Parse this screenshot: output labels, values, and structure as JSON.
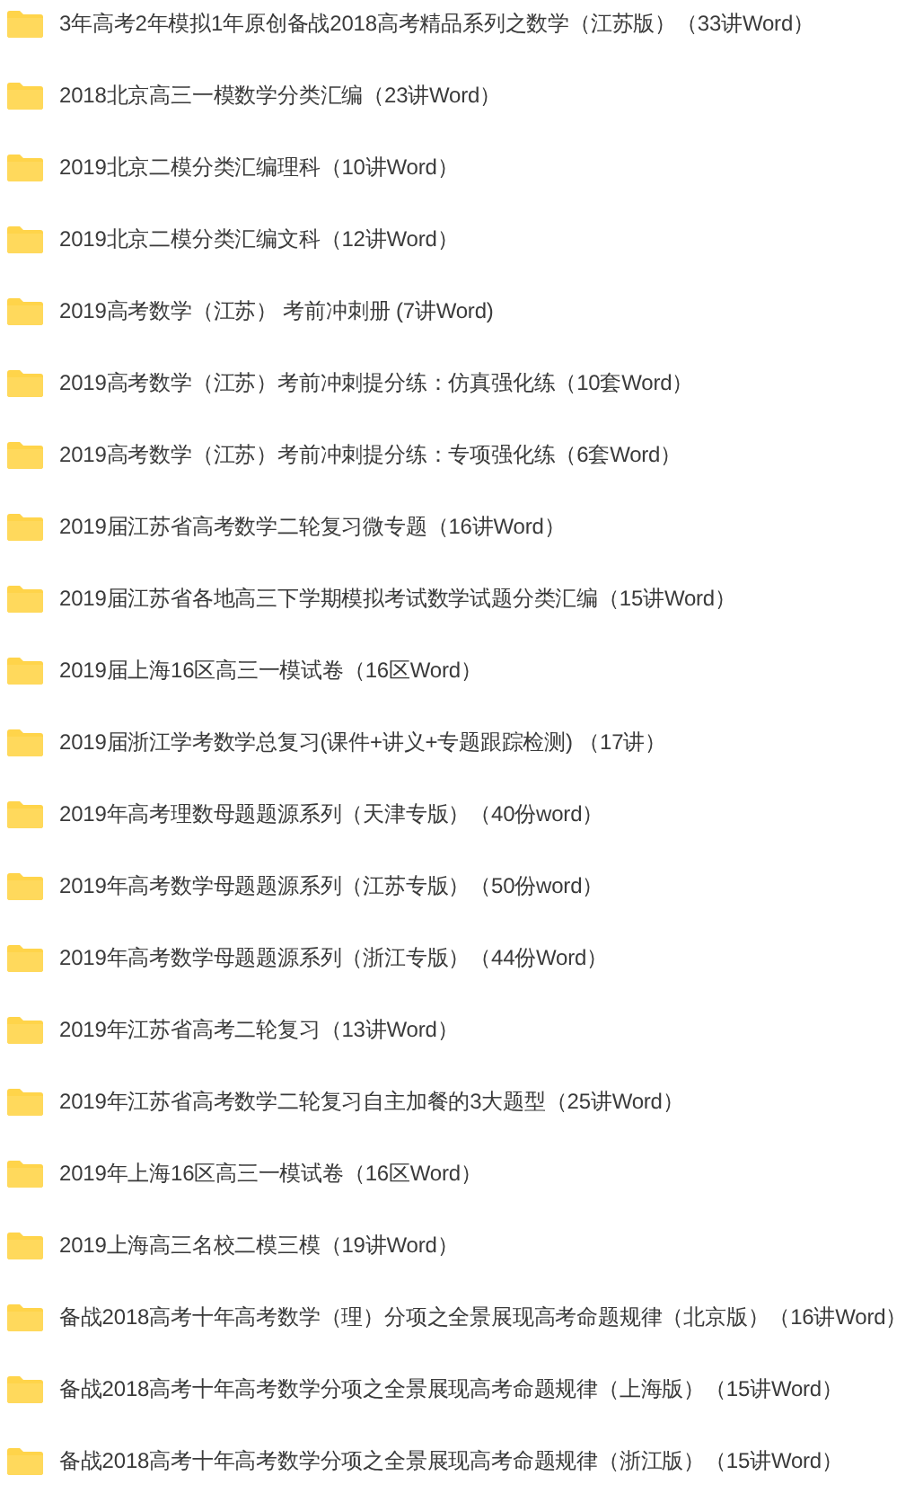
{
  "folders": [
    {
      "name": "3年高考2年模拟1年原创备战2018高考精品系列之数学（江苏版）（33讲Word）"
    },
    {
      "name": "2018北京高三一模数学分类汇编（23讲Word）"
    },
    {
      "name": "2019北京二模分类汇编理科（10讲Word）"
    },
    {
      "name": "2019北京二模分类汇编文科（12讲Word）"
    },
    {
      "name": "2019高考数学（江苏） 考前冲刺册 (7讲Word)"
    },
    {
      "name": "2019高考数学（江苏）考前冲刺提分练：仿真强化练（10套Word）"
    },
    {
      "name": "2019高考数学（江苏）考前冲刺提分练：专项强化练（6套Word）"
    },
    {
      "name": "2019届江苏省高考数学二轮复习微专题（16讲Word）"
    },
    {
      "name": "2019届江苏省各地高三下学期模拟考试数学试题分类汇编（15讲Word）"
    },
    {
      "name": "2019届上海16区高三一模试卷（16区Word）"
    },
    {
      "name": "2019届浙江学考数学总复习(课件+讲义+专题跟踪检测) （17讲）"
    },
    {
      "name": "2019年高考理数母题题源系列（天津专版）（40份word）"
    },
    {
      "name": "2019年高考数学母题题源系列（江苏专版）（50份word）"
    },
    {
      "name": "2019年高考数学母题题源系列（浙江专版）（44份Word）"
    },
    {
      "name": "2019年江苏省高考二轮复习（13讲Word）"
    },
    {
      "name": "2019年江苏省高考数学二轮复习自主加餐的3大题型（25讲Word）"
    },
    {
      "name": "2019年上海16区高三一模试卷（16区Word）"
    },
    {
      "name": "2019上海高三名校二模三模（19讲Word）"
    },
    {
      "name": "备战2018高考十年高考数学（理）分项之全景展现高考命题规律（北京版）（16讲Word）"
    },
    {
      "name": "备战2018高考十年高考数学分项之全景展现高考命题规律（上海版）（15讲Word）"
    },
    {
      "name": "备战2018高考十年高考数学分项之全景展现高考命题规律（浙江版）（15讲Word）"
    }
  ]
}
